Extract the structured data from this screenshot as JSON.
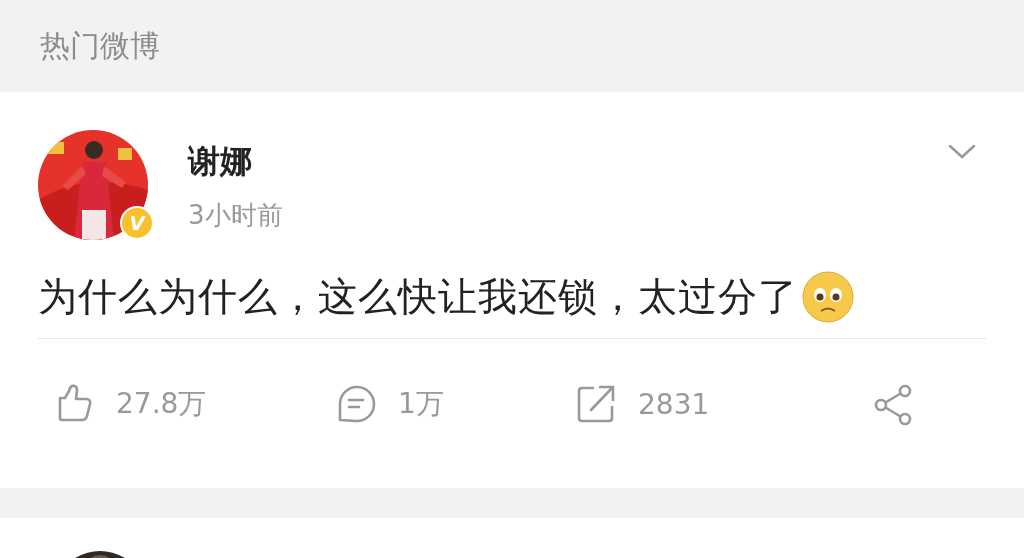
{
  "section_header": {
    "title": "热门微博"
  },
  "post": {
    "author": "谢娜",
    "verified_badge": "V",
    "time": "3小时前",
    "text": "为什么为什么，这么快让我还锁，太过分了",
    "actions": [
      {
        "kind": "like",
        "count": "27.8万"
      },
      {
        "kind": "comment",
        "count": "1万"
      },
      {
        "kind": "repost",
        "count": "2831"
      },
      {
        "kind": "share"
      }
    ]
  }
}
